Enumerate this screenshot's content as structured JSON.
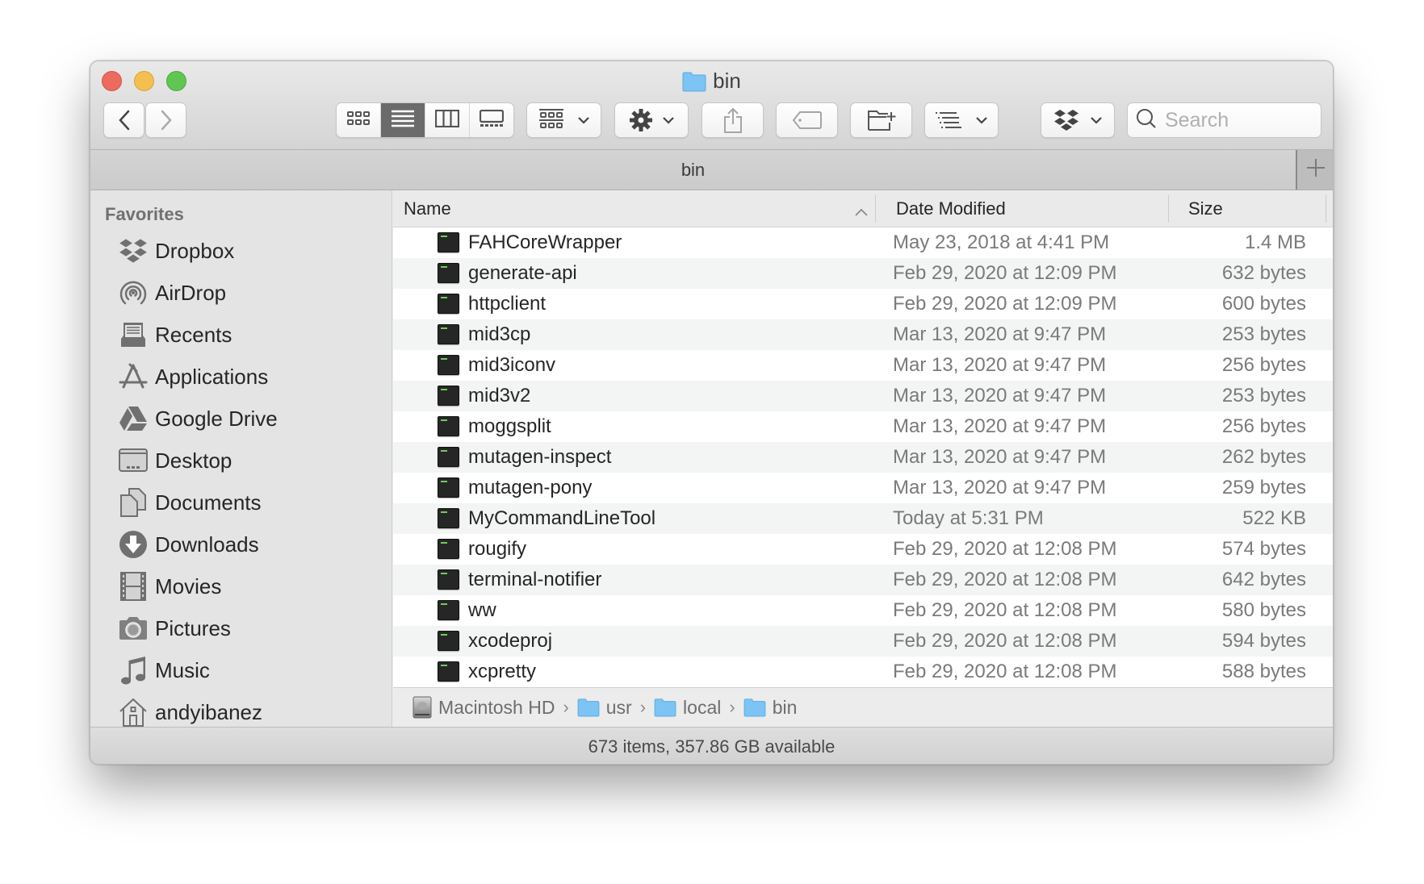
{
  "window": {
    "title": "bin",
    "title_icon": "folder-icon"
  },
  "toolbar": {
    "back_icon": "chevron-left-icon",
    "forward_icon": "chevron-right-icon",
    "views": [
      {
        "name": "icon-view",
        "icon": "grid-icon",
        "active": false
      },
      {
        "name": "list-view",
        "icon": "list-icon",
        "active": true
      },
      {
        "name": "column-view",
        "icon": "columns-icon",
        "active": false
      },
      {
        "name": "gallery-view",
        "icon": "gallery-icon",
        "active": false
      }
    ],
    "group_by_icon": "group-by-icon",
    "action_icon": "gear-icon",
    "share_icon": "share-icon",
    "tag_icon": "tag-icon",
    "new_folder_icon": "new-folder-icon",
    "sort_icon": "sort-list-icon",
    "dropbox_icon": "dropbox-icon",
    "search_placeholder": "Search",
    "search_value": ""
  },
  "tabbar": {
    "tab_label": "bin",
    "add_icon": "plus-icon"
  },
  "sidebar": {
    "heading": "Favorites",
    "items": [
      {
        "label": "Dropbox",
        "icon": "dropbox-icon"
      },
      {
        "label": "AirDrop",
        "icon": "airdrop-icon"
      },
      {
        "label": "Recents",
        "icon": "recents-icon"
      },
      {
        "label": "Applications",
        "icon": "applications-icon"
      },
      {
        "label": "Google Drive",
        "icon": "google-drive-icon"
      },
      {
        "label": "Desktop",
        "icon": "desktop-icon"
      },
      {
        "label": "Documents",
        "icon": "documents-icon"
      },
      {
        "label": "Downloads",
        "icon": "downloads-icon"
      },
      {
        "label": "Movies",
        "icon": "movies-icon"
      },
      {
        "label": "Pictures",
        "icon": "pictures-icon"
      },
      {
        "label": "Music",
        "icon": "music-icon"
      },
      {
        "label": "andyibanez",
        "icon": "home-icon"
      }
    ]
  },
  "list": {
    "columns": {
      "name": "Name",
      "date": "Date Modified",
      "size": "Size"
    },
    "sort_column": "Name",
    "sort_direction": "ascending",
    "files": [
      {
        "name": "FAHCoreWrapper",
        "date": "May 23, 2018 at 4:41 PM",
        "size": "1.4 MB"
      },
      {
        "name": "generate-api",
        "date": "Feb 29, 2020 at 12:09 PM",
        "size": "632 bytes"
      },
      {
        "name": "httpclient",
        "date": "Feb 29, 2020 at 12:09 PM",
        "size": "600 bytes"
      },
      {
        "name": "mid3cp",
        "date": "Mar 13, 2020 at 9:47 PM",
        "size": "253 bytes"
      },
      {
        "name": "mid3iconv",
        "date": "Mar 13, 2020 at 9:47 PM",
        "size": "256 bytes"
      },
      {
        "name": "mid3v2",
        "date": "Mar 13, 2020 at 9:47 PM",
        "size": "253 bytes"
      },
      {
        "name": "moggsplit",
        "date": "Mar 13, 2020 at 9:47 PM",
        "size": "256 bytes"
      },
      {
        "name": "mutagen-inspect",
        "date": "Mar 13, 2020 at 9:47 PM",
        "size": "262 bytes"
      },
      {
        "name": "mutagen-pony",
        "date": "Mar 13, 2020 at 9:47 PM",
        "size": "259 bytes"
      },
      {
        "name": "MyCommandLineTool",
        "date": "Today at 5:31 PM",
        "size": "522 KB"
      },
      {
        "name": "rougify",
        "date": "Feb 29, 2020 at 12:08 PM",
        "size": "574 bytes"
      },
      {
        "name": "terminal-notifier",
        "date": "Feb 29, 2020 at 12:08 PM",
        "size": "642 bytes"
      },
      {
        "name": "ww",
        "date": "Feb 29, 2020 at 12:08 PM",
        "size": "580 bytes"
      },
      {
        "name": "xcodeproj",
        "date": "Feb 29, 2020 at 12:08 PM",
        "size": "594 bytes"
      },
      {
        "name": "xcpretty",
        "date": "Feb 29, 2020 at 12:08 PM",
        "size": "588 bytes"
      }
    ]
  },
  "pathbar": {
    "crumbs": [
      {
        "label": "Macintosh HD",
        "icon": "hard-drive-icon"
      },
      {
        "label": "usr",
        "icon": "folder-icon"
      },
      {
        "label": "local",
        "icon": "folder-icon"
      },
      {
        "label": "bin",
        "icon": "folder-icon"
      }
    ]
  },
  "status": {
    "text": "673 items, 357.86 GB available"
  },
  "colors": {
    "close": "#ed6a5e",
    "minimize": "#f5bf4f",
    "maximize": "#61c554",
    "folder": "#7cc4f4",
    "selected_view": "#6b6b6b",
    "exec_text": "#6ccf5c"
  }
}
